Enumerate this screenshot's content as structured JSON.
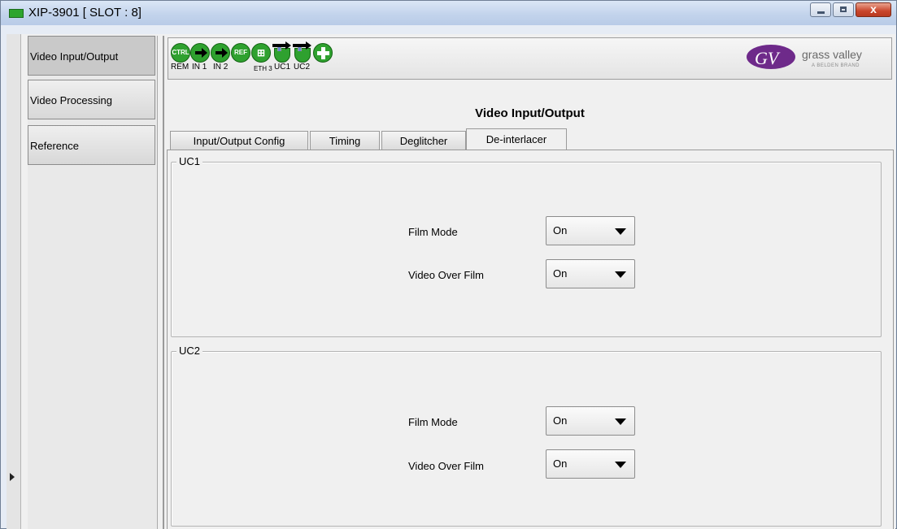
{
  "window": {
    "title": "XIP-3901 [ SLOT : 8]",
    "close_glyph": "x"
  },
  "nav": {
    "items": [
      {
        "label": "Video Input/Output",
        "selected": true
      },
      {
        "label": "Video Processing",
        "selected": false
      },
      {
        "label": "Reference",
        "selected": false
      }
    ]
  },
  "toolbar": {
    "icons": [
      {
        "name": "ctrl-status-icon",
        "text": "CTRL",
        "label": "REM"
      },
      {
        "name": "input-1-icon",
        "text": "",
        "label": "IN 1"
      },
      {
        "name": "input-2-icon",
        "text": "",
        "label": "IN 2"
      },
      {
        "name": "reference-icon",
        "text": "REF",
        "label": ""
      },
      {
        "name": "ethernet-icon",
        "text": "",
        "label": "ETH 3"
      },
      {
        "name": "uc1-icon",
        "text": "",
        "label": "UC1"
      },
      {
        "name": "uc2-icon",
        "text": "",
        "label": "UC2"
      },
      {
        "name": "health-plus-icon",
        "text": "",
        "label": ""
      }
    ],
    "logo": {
      "mark": "GV",
      "name": "grass valley",
      "sub": "A BELDEN BRAND",
      "color": "#6e2a8a"
    }
  },
  "page": {
    "title": "Video Input/Output",
    "tabs": [
      {
        "label": "Input/Output Config",
        "active": false
      },
      {
        "label": "Timing",
        "active": false
      },
      {
        "label": "Deglitcher",
        "active": false
      },
      {
        "label": "De-interlacer",
        "active": true
      }
    ]
  },
  "groups": [
    {
      "title": "UC1",
      "fields": [
        {
          "label": "Film Mode",
          "value": "On"
        },
        {
          "label": "Video Over Film",
          "value": "On"
        }
      ]
    },
    {
      "title": "UC2",
      "fields": [
        {
          "label": "Film Mode",
          "value": "On"
        },
        {
          "label": "Video Over Film",
          "value": "On"
        }
      ]
    }
  ]
}
